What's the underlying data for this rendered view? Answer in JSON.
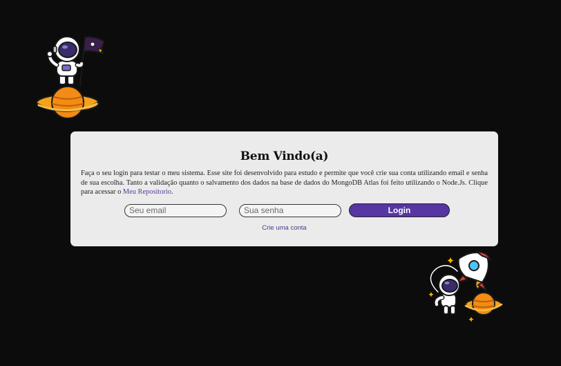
{
  "card": {
    "title": "Bem Vindo(a)",
    "description_text": "Faça o seu login para testar o meu sistema. Esse site foi desenvolvido para estudo e permite que você crie sua conta utilizando email e senha de sua escolha. Tanto a validação quanto o salvamento dos dados na base de dados do MongoDB Atlas foi feito utilizando o Node.Js. Clique para acessar o ",
    "repo_link": "Meu Repositorio",
    "description_end": "."
  },
  "form": {
    "email_placeholder": "Seu email",
    "password_placeholder": "Sua senha",
    "login_label": "Login",
    "create_account_link": "Crie uma conta"
  },
  "colors": {
    "background": "#0c0c0c",
    "card": "#ebebeb",
    "accent": "#5735a3",
    "link": "#5a3a99"
  },
  "illustrations": {
    "top_left": "astronaut-on-planet-with-flag",
    "bottom_right": "astronaut-with-rocket-and-planet"
  }
}
